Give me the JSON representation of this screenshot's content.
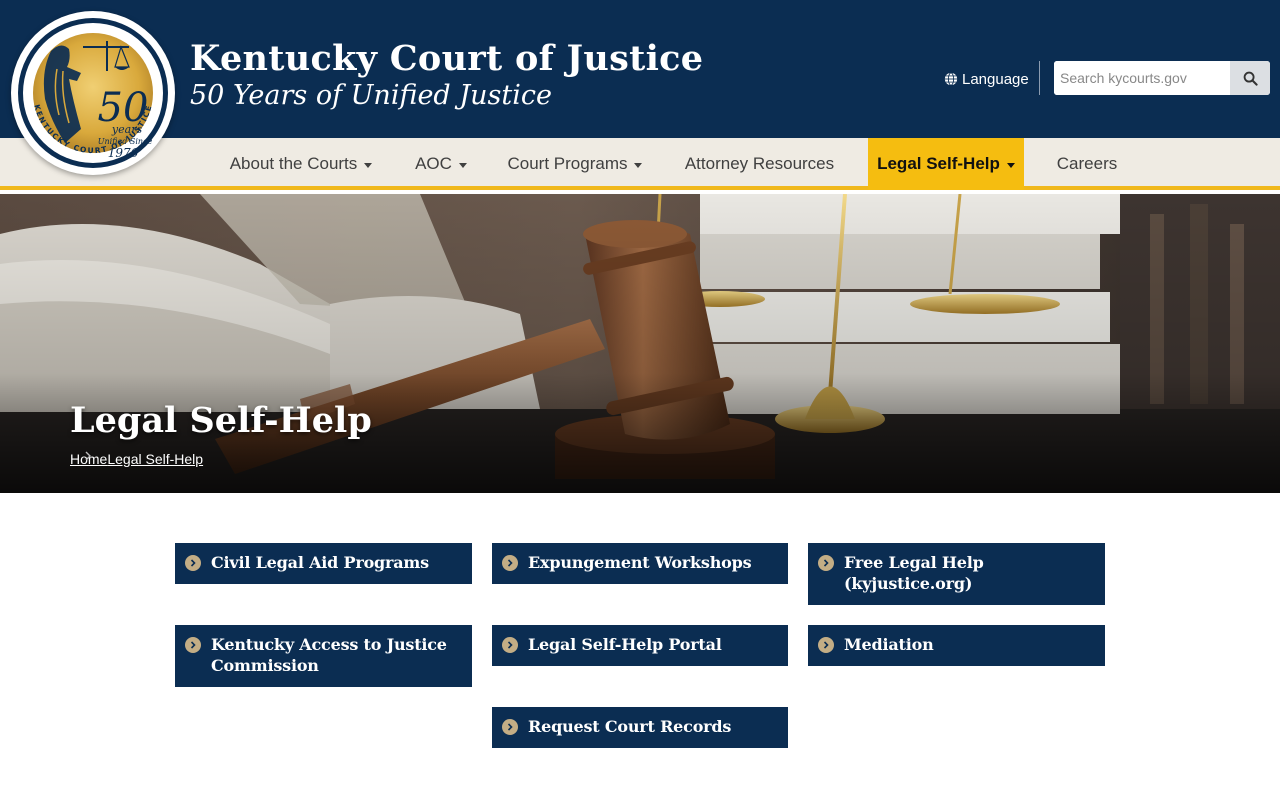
{
  "header": {
    "title": "Kentucky Court of Justice",
    "subtitle": "50 Years of Unified Justice",
    "seal": {
      "number": "50",
      "years_word": "years",
      "unified_since": "Unified Since",
      "year": "1976",
      "ring_text": "KENTUCKY COURT OF JUSTICE"
    },
    "language_label": "Language",
    "search_placeholder": "Search kycourts.gov"
  },
  "nav": {
    "items": [
      {
        "label": "About the Courts",
        "dropdown": true
      },
      {
        "label": "AOC",
        "dropdown": true
      },
      {
        "label": "Court Programs",
        "dropdown": true
      },
      {
        "label": "Attorney Resources",
        "dropdown": false
      },
      {
        "label": "Legal Self-Help",
        "dropdown": true,
        "active": true
      },
      {
        "label": "Careers",
        "dropdown": false
      }
    ]
  },
  "hero": {
    "title": "Legal Self-Help",
    "breadcrumb": [
      "Home",
      "Legal Self-Help"
    ]
  },
  "links": [
    "Civil Legal Aid Programs",
    "Expungement Workshops",
    "Free Legal Help (kyjustice.org)",
    "Kentucky Access to Justice Commission",
    "Legal Self-Help Portal",
    "Mediation",
    "Request Court Records"
  ],
  "colors": {
    "navy": "#0b2d52",
    "gold": "#f5bd10",
    "nav_bg": "#efebe3",
    "chevron": "#c3ad85"
  },
  "icons": {
    "language": "globe-icon",
    "search": "search-icon",
    "nav_caret": "caret-down-icon",
    "breadcrumb_separator": "chevron-right-icon",
    "link_bullet": "chevron-circle-right-icon"
  }
}
